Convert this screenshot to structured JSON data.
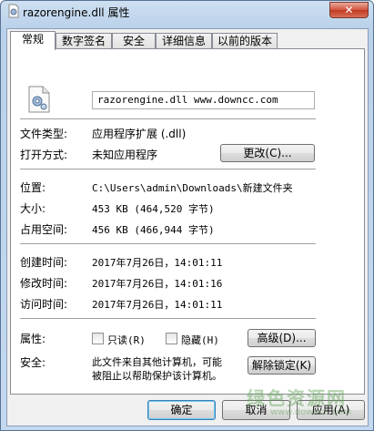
{
  "window": {
    "title": "razorengine.dll 属性",
    "close_label": "✕"
  },
  "tabs": [
    {
      "label": "常规",
      "active": true
    },
    {
      "label": "数字签名",
      "active": false
    },
    {
      "label": "安全",
      "active": false
    },
    {
      "label": "详细信息",
      "active": false
    },
    {
      "label": "以前的版本",
      "active": false
    }
  ],
  "general": {
    "file_icon": "dll-gear-file-icon",
    "file_name": "razorengine.dll  www.downcc.com",
    "file_type_label": "文件类型:",
    "file_type_value": "应用程序扩展 (.dll)",
    "open_with_label": "打开方式:",
    "open_with_value": "未知应用程序",
    "change_button": "更改(C)...",
    "location_label": "位置:",
    "location_value": "C:\\Users\\admin\\Downloads\\新建文件夹",
    "size_label": "大小:",
    "size_value": "453 KB (464,520 字节)",
    "disk_size_label": "占用空间:",
    "disk_size_value": "456 KB (466,944 字节)",
    "created_label": "创建时间:",
    "created_value": "2017年7月26日，14:01:11",
    "modified_label": "修改时间:",
    "modified_value": "2017年7月26日，14:01:16",
    "accessed_label": "访问时间:",
    "accessed_value": "2017年7月26日，14:01:11",
    "attributes_label": "属性:",
    "readonly_label": "只读(R)",
    "readonly_checked": false,
    "hidden_label": "隐藏(H)",
    "hidden_checked": false,
    "advanced_button": "高级(D)...",
    "security_label": "安全:",
    "security_text_line1": "此文件来自其他计算机，可能",
    "security_text_line2": "被阻止以帮助保护该计算机。",
    "unblock_button": "解除锁定(K)"
  },
  "footer": {
    "ok_button": "确定",
    "cancel_button": "取消",
    "apply_button": "应用(A)"
  },
  "watermark": {
    "text": "绿色资源网",
    "sub": "www.downcc.com"
  }
}
